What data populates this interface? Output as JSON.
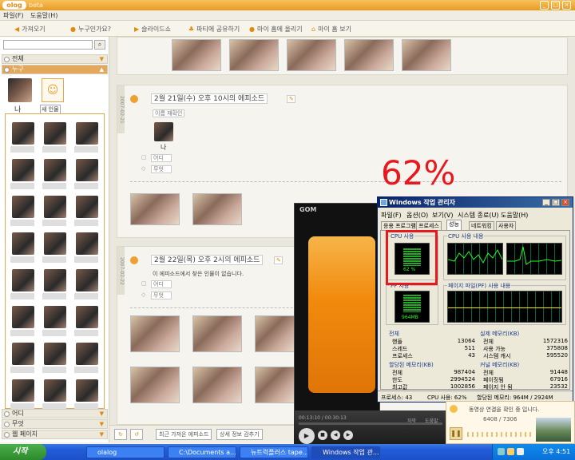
{
  "app": {
    "logo": "olog",
    "beta": "beta"
  },
  "menu": {
    "file": "파일(F)",
    "help": "도움말(H)"
  },
  "toolbar": {
    "items": [
      "가져오기",
      "누구인가요?",
      "슬라이드쇼",
      "파티에 공유하기",
      "마이 홈에 올리기",
      "마이 홈 보기"
    ]
  },
  "sidebar": {
    "all": "전체",
    "who": "누구",
    "me": "나",
    "new_person": "새 인물",
    "where": "어디",
    "what": "무엇",
    "web": "웹 페이지"
  },
  "episodes": [
    {
      "date": "2007-02-21",
      "title": "2월 21일(수) 오후 10시의 에피소드",
      "name_btn": "이름 재확인",
      "person": "나",
      "where": "어디",
      "what": "무엇"
    },
    {
      "date": "2007-02-22",
      "title": "2월 22일(목) 오후 2시의 에피소드",
      "none_found": "이 에피소드에서 찾은 인물이 없습니다.",
      "where": "어디",
      "what": "무엇"
    }
  ],
  "main_bottom": {
    "recent": "최근 가져온 에피소드",
    "detail": "상세 정보 감추기"
  },
  "annotation": {
    "percent": "62%"
  },
  "gom": {
    "logo": "GOM",
    "time": "00:13:10 / 00:30:13",
    "subtitle": "자막",
    "tips": "도움말"
  },
  "task_manager": {
    "title": "Windows 작업 관리자",
    "menu": [
      "파일(F)",
      "옵션(O)",
      "보기(V)",
      "시스템 종료(U)",
      "도움말(H)"
    ],
    "tabs": [
      "응용 프로그램",
      "프로세스",
      "성능",
      "네트워킹",
      "사용자"
    ],
    "cpu_usage_label": "CPU 사용",
    "cpu_usage_value": "62 %",
    "cpu_history_label": "CPU 사용 내용",
    "pf_label": "PF 사용",
    "pf_value": "964MB",
    "pf_history_label": "페이지 파일(PF) 사용 내용",
    "totals": {
      "title": "전체",
      "rows": [
        [
          "핸들",
          "13064"
        ],
        [
          "스레드",
          "511"
        ],
        [
          "프로세스",
          "43"
        ]
      ]
    },
    "physical": {
      "title": "실제 메모리(KB)",
      "rows": [
        [
          "전체",
          "1572316"
        ],
        [
          "사용 가능",
          "375808"
        ],
        [
          "시스템 캐시",
          "595520"
        ]
      ]
    },
    "commit": {
      "title": "할당된 메모리(KB)",
      "rows": [
        [
          "전체",
          "987404"
        ],
        [
          "한도",
          "2994524"
        ],
        [
          "최고값",
          "1002856"
        ]
      ]
    },
    "kernel": {
      "title": "커널 메모리(KB)",
      "rows": [
        [
          "전체",
          "91448"
        ],
        [
          "페이징됨",
          "67916"
        ],
        [
          "페이지 안 됨",
          "23532"
        ]
      ]
    },
    "status": {
      "processes": "프로세스: 43",
      "cpu": "CPU 사용: 62%",
      "mem": "할당된 메모리: 964M / 2924M"
    }
  },
  "notification": {
    "text": "동영상 연결을 확인 중 입니다.",
    "counter": "6408 / 7306"
  },
  "taskbar": {
    "start": "시작",
    "buttons": [
      "olalog",
      "C:\\Documents a...",
      "뉴트럭플러스 tape...",
      "Windows 작업 관..."
    ],
    "clock": "오후 4:51"
  }
}
